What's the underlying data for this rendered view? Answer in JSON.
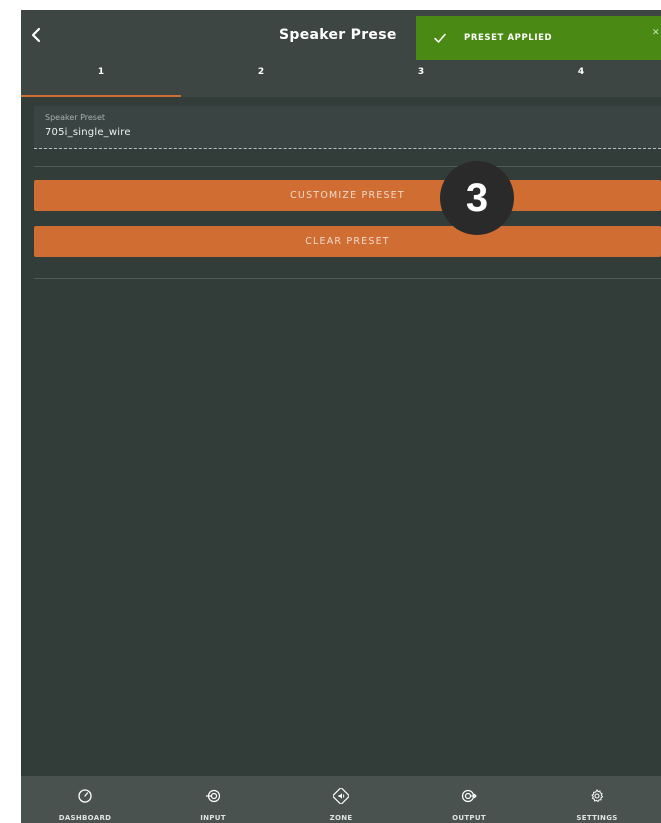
{
  "header": {
    "title": "Speaker Prese",
    "back_icon": "chevron-left-icon"
  },
  "tabs": [
    {
      "label": "1",
      "active": true
    },
    {
      "label": "2",
      "active": false
    },
    {
      "label": "3",
      "active": false
    },
    {
      "label": "4",
      "active": false
    }
  ],
  "toast": {
    "message": "PRESET APPLIED",
    "icon": "check-icon",
    "close_icon": "close-icon",
    "color": "#4a8a14"
  },
  "preset": {
    "label": "Speaker Preset",
    "value": "705i_single_wire"
  },
  "buttons": {
    "customize": "CUSTOMIZE PRESET",
    "clear": "CLEAR PRESET"
  },
  "step_badge": "3",
  "bottom_nav": [
    {
      "label": "DASHBOARD",
      "icon": "gauge-icon"
    },
    {
      "label": "INPUT",
      "icon": "input-icon"
    },
    {
      "label": "ZONE",
      "icon": "speaker-icon"
    },
    {
      "label": "OUTPUT",
      "icon": "output-icon"
    },
    {
      "label": "SETTINGS",
      "icon": "gear-icon"
    }
  ],
  "colors": {
    "accent": "#d06d33",
    "background": "#323d3a",
    "header": "#3e4644",
    "nav": "#4a5250"
  }
}
